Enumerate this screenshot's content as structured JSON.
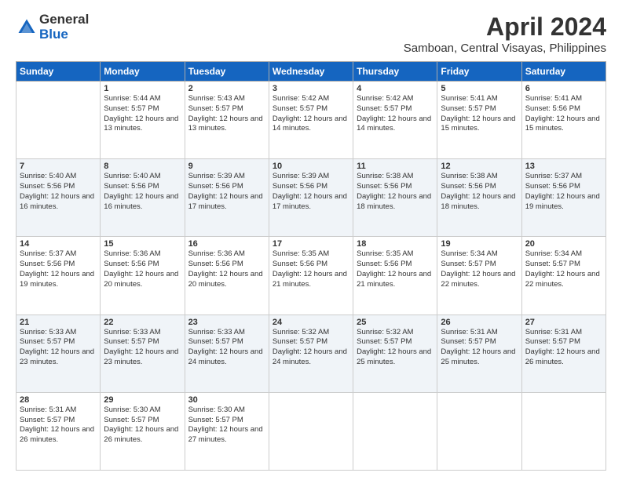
{
  "logo": {
    "general": "General",
    "blue": "Blue"
  },
  "header": {
    "month": "April 2024",
    "location": "Samboan, Central Visayas, Philippines"
  },
  "weekdays": [
    "Sunday",
    "Monday",
    "Tuesday",
    "Wednesday",
    "Thursday",
    "Friday",
    "Saturday"
  ],
  "weeks": [
    [
      {
        "day": "",
        "sunrise": "",
        "sunset": "",
        "daylight": ""
      },
      {
        "day": "1",
        "sunrise": "Sunrise: 5:44 AM",
        "sunset": "Sunset: 5:57 PM",
        "daylight": "Daylight: 12 hours and 13 minutes."
      },
      {
        "day": "2",
        "sunrise": "Sunrise: 5:43 AM",
        "sunset": "Sunset: 5:57 PM",
        "daylight": "Daylight: 12 hours and 13 minutes."
      },
      {
        "day": "3",
        "sunrise": "Sunrise: 5:42 AM",
        "sunset": "Sunset: 5:57 PM",
        "daylight": "Daylight: 12 hours and 14 minutes."
      },
      {
        "day": "4",
        "sunrise": "Sunrise: 5:42 AM",
        "sunset": "Sunset: 5:57 PM",
        "daylight": "Daylight: 12 hours and 14 minutes."
      },
      {
        "day": "5",
        "sunrise": "Sunrise: 5:41 AM",
        "sunset": "Sunset: 5:57 PM",
        "daylight": "Daylight: 12 hours and 15 minutes."
      },
      {
        "day": "6",
        "sunrise": "Sunrise: 5:41 AM",
        "sunset": "Sunset: 5:56 PM",
        "daylight": "Daylight: 12 hours and 15 minutes."
      }
    ],
    [
      {
        "day": "7",
        "sunrise": "Sunrise: 5:40 AM",
        "sunset": "Sunset: 5:56 PM",
        "daylight": "Daylight: 12 hours and 16 minutes."
      },
      {
        "day": "8",
        "sunrise": "Sunrise: 5:40 AM",
        "sunset": "Sunset: 5:56 PM",
        "daylight": "Daylight: 12 hours and 16 minutes."
      },
      {
        "day": "9",
        "sunrise": "Sunrise: 5:39 AM",
        "sunset": "Sunset: 5:56 PM",
        "daylight": "Daylight: 12 hours and 17 minutes."
      },
      {
        "day": "10",
        "sunrise": "Sunrise: 5:39 AM",
        "sunset": "Sunset: 5:56 PM",
        "daylight": "Daylight: 12 hours and 17 minutes."
      },
      {
        "day": "11",
        "sunrise": "Sunrise: 5:38 AM",
        "sunset": "Sunset: 5:56 PM",
        "daylight": "Daylight: 12 hours and 18 minutes."
      },
      {
        "day": "12",
        "sunrise": "Sunrise: 5:38 AM",
        "sunset": "Sunset: 5:56 PM",
        "daylight": "Daylight: 12 hours and 18 minutes."
      },
      {
        "day": "13",
        "sunrise": "Sunrise: 5:37 AM",
        "sunset": "Sunset: 5:56 PM",
        "daylight": "Daylight: 12 hours and 19 minutes."
      }
    ],
    [
      {
        "day": "14",
        "sunrise": "Sunrise: 5:37 AM",
        "sunset": "Sunset: 5:56 PM",
        "daylight": "Daylight: 12 hours and 19 minutes."
      },
      {
        "day": "15",
        "sunrise": "Sunrise: 5:36 AM",
        "sunset": "Sunset: 5:56 PM",
        "daylight": "Daylight: 12 hours and 20 minutes."
      },
      {
        "day": "16",
        "sunrise": "Sunrise: 5:36 AM",
        "sunset": "Sunset: 5:56 PM",
        "daylight": "Daylight: 12 hours and 20 minutes."
      },
      {
        "day": "17",
        "sunrise": "Sunrise: 5:35 AM",
        "sunset": "Sunset: 5:56 PM",
        "daylight": "Daylight: 12 hours and 21 minutes."
      },
      {
        "day": "18",
        "sunrise": "Sunrise: 5:35 AM",
        "sunset": "Sunset: 5:56 PM",
        "daylight": "Daylight: 12 hours and 21 minutes."
      },
      {
        "day": "19",
        "sunrise": "Sunrise: 5:34 AM",
        "sunset": "Sunset: 5:57 PM",
        "daylight": "Daylight: 12 hours and 22 minutes."
      },
      {
        "day": "20",
        "sunrise": "Sunrise: 5:34 AM",
        "sunset": "Sunset: 5:57 PM",
        "daylight": "Daylight: 12 hours and 22 minutes."
      }
    ],
    [
      {
        "day": "21",
        "sunrise": "Sunrise: 5:33 AM",
        "sunset": "Sunset: 5:57 PM",
        "daylight": "Daylight: 12 hours and 23 minutes."
      },
      {
        "day": "22",
        "sunrise": "Sunrise: 5:33 AM",
        "sunset": "Sunset: 5:57 PM",
        "daylight": "Daylight: 12 hours and 23 minutes."
      },
      {
        "day": "23",
        "sunrise": "Sunrise: 5:33 AM",
        "sunset": "Sunset: 5:57 PM",
        "daylight": "Daylight: 12 hours and 24 minutes."
      },
      {
        "day": "24",
        "sunrise": "Sunrise: 5:32 AM",
        "sunset": "Sunset: 5:57 PM",
        "daylight": "Daylight: 12 hours and 24 minutes."
      },
      {
        "day": "25",
        "sunrise": "Sunrise: 5:32 AM",
        "sunset": "Sunset: 5:57 PM",
        "daylight": "Daylight: 12 hours and 25 minutes."
      },
      {
        "day": "26",
        "sunrise": "Sunrise: 5:31 AM",
        "sunset": "Sunset: 5:57 PM",
        "daylight": "Daylight: 12 hours and 25 minutes."
      },
      {
        "day": "27",
        "sunrise": "Sunrise: 5:31 AM",
        "sunset": "Sunset: 5:57 PM",
        "daylight": "Daylight: 12 hours and 26 minutes."
      }
    ],
    [
      {
        "day": "28",
        "sunrise": "Sunrise: 5:31 AM",
        "sunset": "Sunset: 5:57 PM",
        "daylight": "Daylight: 12 hours and 26 minutes."
      },
      {
        "day": "29",
        "sunrise": "Sunrise: 5:30 AM",
        "sunset": "Sunset: 5:57 PM",
        "daylight": "Daylight: 12 hours and 26 minutes."
      },
      {
        "day": "30",
        "sunrise": "Sunrise: 5:30 AM",
        "sunset": "Sunset: 5:57 PM",
        "daylight": "Daylight: 12 hours and 27 minutes."
      },
      {
        "day": "",
        "sunrise": "",
        "sunset": "",
        "daylight": ""
      },
      {
        "day": "",
        "sunrise": "",
        "sunset": "",
        "daylight": ""
      },
      {
        "day": "",
        "sunrise": "",
        "sunset": "",
        "daylight": ""
      },
      {
        "day": "",
        "sunrise": "",
        "sunset": "",
        "daylight": ""
      }
    ]
  ]
}
